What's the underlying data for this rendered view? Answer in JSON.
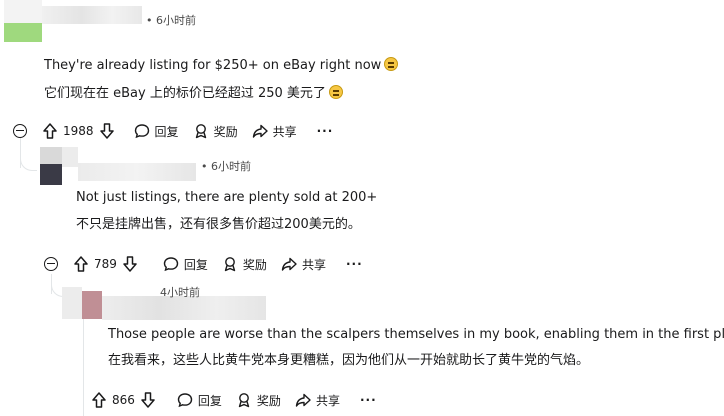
{
  "comments": [
    {
      "time": "• 6小时前",
      "text_en": "They're already listing for $250+ on eBay right now",
      "text_zh": "它们现在在 eBay 上的标价已经超过 250 美元了",
      "emoji": "expressionless-face",
      "votes": "1988"
    },
    {
      "time": "• 6小时前",
      "text_en": "Not just listings, there are plenty sold at 200+",
      "text_zh": "不只是挂牌出售，还有很多售价超过200美元的。",
      "votes": "789"
    },
    {
      "time": "4小时前",
      "text_en": "Those people are worse than the scalpers themselves in my book, enabling them in the first place.",
      "text_zh": "在我看来，这些人比黄牛党本身更糟糕，因为他们从一开始就助长了黄牛党的气焰。",
      "votes": "866"
    }
  ],
  "actions": {
    "reply": "回复",
    "award": "奖励",
    "share": "共享",
    "more": "···"
  },
  "icons": [
    "collapse-icon",
    "upvote-icon",
    "downvote-icon",
    "reply-icon",
    "award-icon",
    "share-icon",
    "more-icon"
  ]
}
